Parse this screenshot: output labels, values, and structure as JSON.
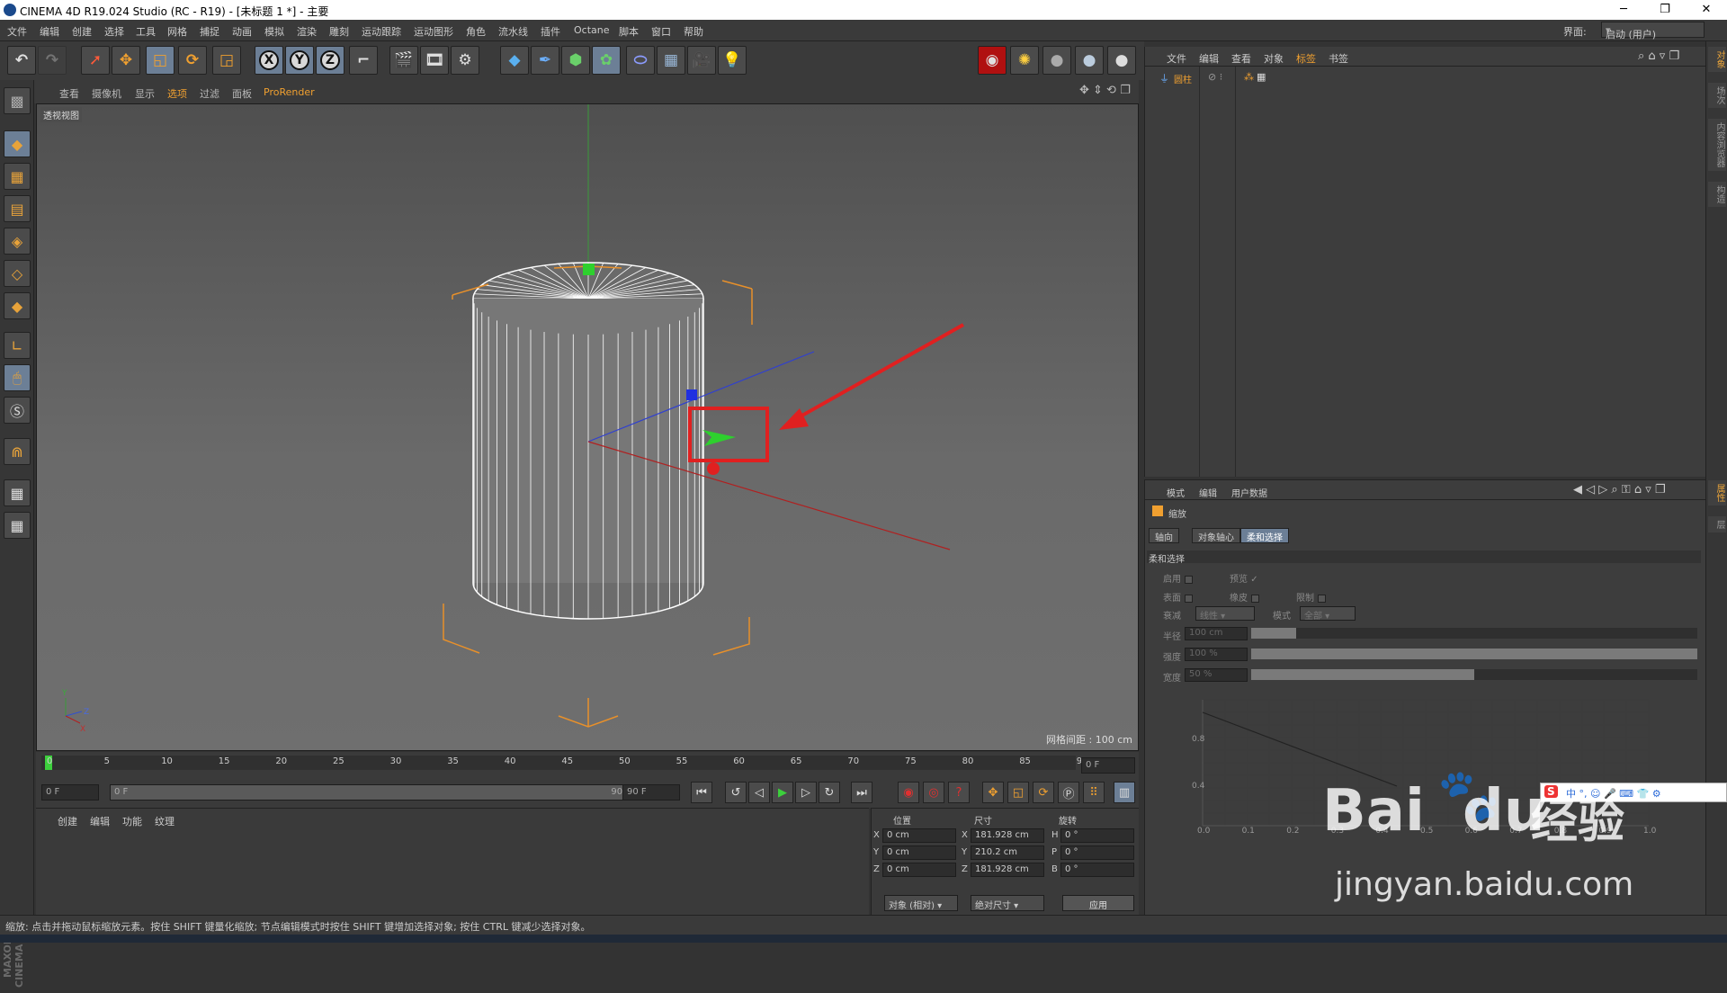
{
  "window": {
    "title": "CINEMA 4D R19.024 Studio (RC - R19) - [未标题 1 *] - 主要",
    "minimize": "─",
    "restore": "❐",
    "close": "✕"
  },
  "menu": [
    "文件",
    "编辑",
    "创建",
    "选择",
    "工具",
    "网格",
    "捕捉",
    "动画",
    "模拟",
    "渲染",
    "雕刻",
    "运动跟踪",
    "运动图形",
    "角色",
    "流水线",
    "插件",
    "Octane",
    "脚本",
    "窗口",
    "帮助"
  ],
  "layout": {
    "label": "界面:",
    "value": "启动 (用户)"
  },
  "toolbar": {
    "axes": [
      "X",
      "Y",
      "Z"
    ]
  },
  "viewport": {
    "menu": [
      "查看",
      "摄像机",
      "显示",
      "选项",
      "过滤",
      "面板",
      "ProRender"
    ],
    "label": "透视视图",
    "grid_distance": "网格间距 : 100 cm",
    "axis_y": "Y",
    "axis_z": "Z",
    "axis_x": "X"
  },
  "timeline": {
    "ticks": [
      "0",
      "5",
      "10",
      "15",
      "20",
      "25",
      "30",
      "35",
      "40",
      "45",
      "50",
      "55",
      "60",
      "65",
      "70",
      "75",
      "80",
      "85",
      "90"
    ],
    "current": "0 F"
  },
  "transport": {
    "start": "0 F",
    "range_start": "0 F",
    "range_end": "90 F",
    "end": "90 F"
  },
  "material_menu": [
    "创建",
    "编辑",
    "功能",
    "纹理"
  ],
  "coords": {
    "headers": [
      "位置",
      "尺寸",
      "旋转"
    ],
    "rows": [
      {
        "a": "X",
        "pos": "0 cm",
        "s": "X",
        "size": "181.928 cm",
        "r": "H",
        "rot": "0 °"
      },
      {
        "a": "Y",
        "pos": "0 cm",
        "s": "Y",
        "size": "210.2 cm",
        "r": "P",
        "rot": "0 °"
      },
      {
        "a": "Z",
        "pos": "0 cm",
        "s": "Z",
        "size": "181.928 cm",
        "r": "B",
        "rot": "0 °"
      }
    ],
    "mode": "对象 (相对)",
    "size_mode": "绝对尺寸",
    "apply": "应用"
  },
  "object_manager": {
    "menu": [
      "文件",
      "编辑",
      "查看",
      "对象",
      "标签",
      "书签"
    ],
    "object": "圆柱"
  },
  "attributes": {
    "menu": [
      "模式",
      "编辑",
      "用户数据"
    ],
    "tool": "缩放",
    "tabs": [
      "轴向",
      "对象轴心",
      "柔和选择"
    ],
    "section": "柔和选择",
    "enable": "启用",
    "preview": "预览",
    "surface": "表面",
    "rubber": "橡皮",
    "restrict": "限制",
    "falloff_label": "衰减",
    "falloff": "线性",
    "mode_label": "模式",
    "mode": "全部",
    "radius_label": "半径",
    "radius": "100 cm",
    "radius_frac": 0.1,
    "strength_label": "强度",
    "strength": "100 %",
    "strength_frac": 1.0,
    "width_label": "宽度",
    "width": "50 %",
    "width_frac": 0.5,
    "graph_y": [
      "0.8",
      "0.4"
    ],
    "graph_x": [
      "0.0",
      "0.1",
      "0.2",
      "0.3",
      "0.4",
      "0.5",
      "0.6",
      "0.7",
      "0.8",
      "0.9",
      "1.0"
    ]
  },
  "right_tabs_top": [
    "对象",
    "场次",
    "内容浏览器",
    "构造"
  ],
  "right_tabs_bottom": [
    "属性",
    "层"
  ],
  "status": "缩放: 点击并拖动鼠标缩放元素。按住 SHIFT 键量化缩放; 节点编辑模式时按住 SHIFT 键增加选择对象; 按住 CTRL 键减少选择对象。",
  "ime": {
    "logo": "S",
    "text": "中 °, ☺ 🎤 ⌨ 👕 ⚙"
  },
  "watermark": {
    "brand": "Bai",
    "paw": "🐾",
    "du": "du",
    "jingyan": "经验",
    "url": "jingyan.baidu.com"
  }
}
